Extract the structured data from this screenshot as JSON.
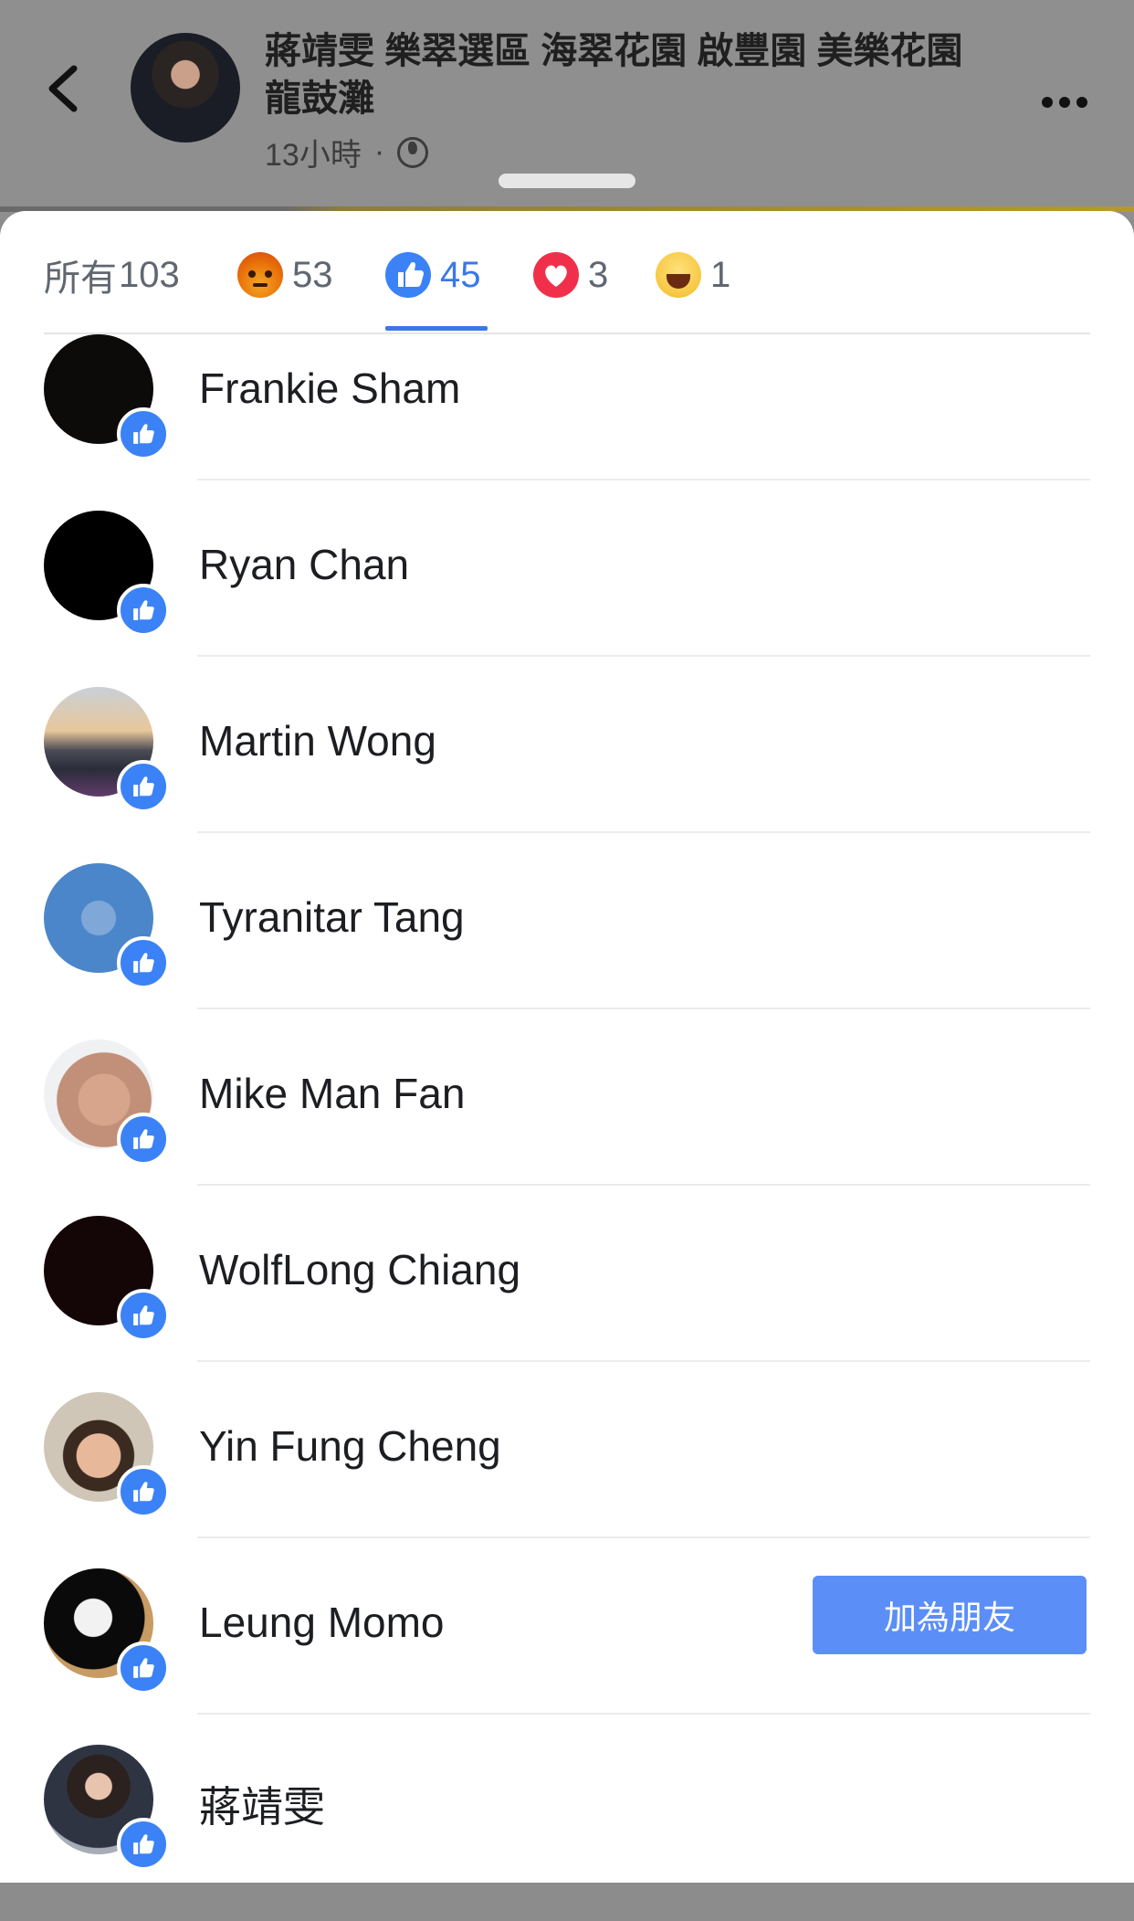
{
  "header": {
    "title": "蔣靖雯  樂翠選區 海翠花園 啟豐園 美樂花園 龍鼓灘",
    "time": "13小時",
    "separator": "·"
  },
  "tabs": [
    {
      "label": "所有",
      "count": "103",
      "icon": "none"
    },
    {
      "label": "",
      "count": "53",
      "icon": "angry-icon"
    },
    {
      "label": "",
      "count": "45",
      "icon": "like-icon",
      "active": true
    },
    {
      "label": "",
      "count": "3",
      "icon": "love-icon"
    },
    {
      "label": "",
      "count": "1",
      "icon": "haha-icon"
    }
  ],
  "people": [
    {
      "name": "Frankie Sham"
    },
    {
      "name": "Ryan Chan"
    },
    {
      "name": "Martin Wong"
    },
    {
      "name": "Tyranitar Tang"
    },
    {
      "name": "Mike Man Fan"
    },
    {
      "name": "WolfLong Chiang"
    },
    {
      "name": "Yin Fung Cheng"
    },
    {
      "name": "Leung Momo",
      "action": "加為朋友"
    },
    {
      "name": "蔣靖雯"
    }
  ],
  "colors": {
    "accent": "#3b78e7",
    "like_blue": "#3b82f7",
    "add_friend_button": "#5b8ef7"
  }
}
